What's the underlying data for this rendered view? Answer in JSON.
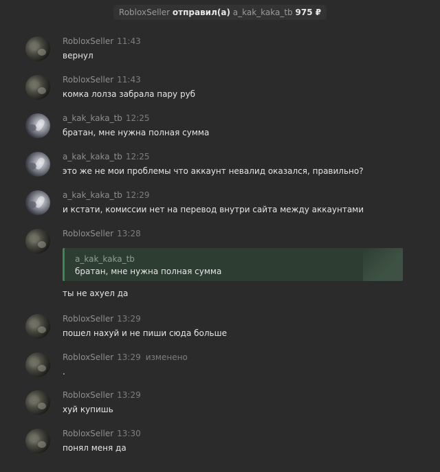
{
  "banner": {
    "seller": "RobloxSeller",
    "action": "отправил(а)",
    "buyer": "a_kak_kaka_tb",
    "amount": "975 ₽"
  },
  "messages": [
    {
      "author": "RobloxSeller",
      "time": "11:43",
      "text": "вернул"
    },
    {
      "author": "RobloxSeller",
      "time": "11:43",
      "text": "комка лолза забрала пару руб"
    },
    {
      "author": "a_kak_kaka_tb",
      "time": "12:25",
      "text": "братан, мне нужна полная сумма"
    },
    {
      "author": "a_kak_kaka_tb",
      "time": "12:25",
      "text": "это же не мои проблемы что аккаунт невалид оказался, правильно?"
    },
    {
      "author": "a_kak_kaka_tb",
      "time": "12:29",
      "text": "и кстати, комиссии нет на перевод внутри сайта между аккаунтами"
    },
    {
      "author": "RobloxSeller",
      "time": "13:28",
      "text": "ты не ахуел да",
      "quote": {
        "author": "a_kak_kaka_tb",
        "text": "братан, мне нужна полная сумма"
      }
    },
    {
      "author": "RobloxSeller",
      "time": "13:29",
      "text": "пошел нахуй и не пиши сюда больше"
    },
    {
      "author": "RobloxSeller",
      "time": "13:29",
      "edited": "изменено",
      "text": "."
    },
    {
      "author": "RobloxSeller",
      "time": "13:29",
      "text": "хуй купишь"
    },
    {
      "author": "RobloxSeller",
      "time": "13:30",
      "text": "понял меня да"
    }
  ]
}
